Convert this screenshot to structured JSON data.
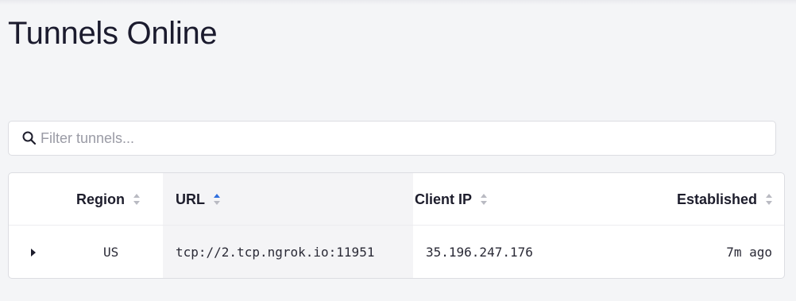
{
  "page": {
    "title": "Tunnels Online"
  },
  "filter": {
    "placeholder": "Filter tunnels...",
    "value": ""
  },
  "table": {
    "columns": [
      {
        "label": "Region",
        "sort": "none"
      },
      {
        "label": "URL",
        "sort": "ascending"
      },
      {
        "label": "Client IP",
        "sort": "none"
      },
      {
        "label": "Established",
        "sort": "none"
      }
    ],
    "rows": [
      {
        "region": "US",
        "url": "tcp://2.tcp.ngrok.io:11951",
        "client_ip": "35.196.247.176",
        "established": "7m ago"
      }
    ]
  },
  "colors": {
    "sort_active": "#2f6fde",
    "sort_inactive": "#b9bac2"
  },
  "icons": {
    "filter": "search-icon",
    "expand": "caret-right-icon",
    "sort": "sort-arrows-icon"
  }
}
